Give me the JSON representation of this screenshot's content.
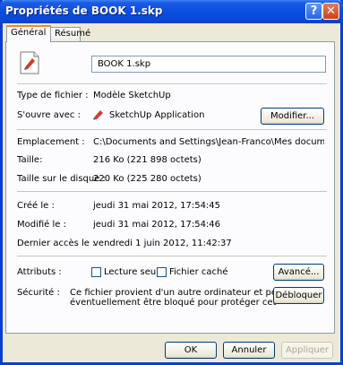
{
  "window": {
    "title": "Propriétés de BOOK 1.skp"
  },
  "tabs": [
    {
      "label": "Général",
      "active": true
    },
    {
      "label": "Résumé",
      "active": false
    }
  ],
  "file": {
    "name": "BOOK 1.skp"
  },
  "type_section": {
    "type_label": "Type de fichier :",
    "type_value": "Modèle SketchUp",
    "opens_label": "S'ouvre avec :",
    "opens_value": "SketchUp Application",
    "modify_button": "Modifier..."
  },
  "location_section": {
    "location_label": "Emplacement :",
    "location_value": "C:\\Documents and Settings\\Jean-Franco\\Mes documents\\Téléchar",
    "size_label": "Taille:",
    "size_value": "216 Ko (221 898 octets)",
    "disk_size_label": "Taille sur le disque :",
    "disk_size_value": "220 Ko (225 280 octets)"
  },
  "dates_section": {
    "created_label": "Créé le :",
    "created_value": "jeudi 31 mai 2012, 17:54:45",
    "modified_label": "Modifié le :",
    "modified_value": "jeudi 31 mai 2012, 17:54:46",
    "accessed_label": "Dernier accès le :",
    "accessed_value": "vendredi 1 juin 2012, 11:42:37"
  },
  "attributes_section": {
    "attributes_label": "Attributs :",
    "readonly_label": "Lecture seule",
    "readonly_checked": false,
    "hidden_label": "Fichier caché",
    "hidden_checked": false,
    "advanced_button": "Avancé...",
    "security_label": "Sécurité :",
    "security_line1": "Ce fichier provient d'un autre ordinateur et peut",
    "security_line2": "éventuellement être bloqué pour protéger cet",
    "unblock_button": "Débloquer"
  },
  "footer": {
    "ok_button": "OK",
    "cancel_button": "Annuler",
    "apply_button": "Appliquer"
  },
  "colors": {
    "titlebar": "#0a4ee0",
    "window_bg": "#ece9d8",
    "panel_bg": "#fcfcfe",
    "active_tab_accent": "#e68b2c"
  },
  "icons": {
    "file": "sketchup-file-icon",
    "app": "sketchup-app-icon",
    "help": "help-icon",
    "close": "close-icon"
  }
}
